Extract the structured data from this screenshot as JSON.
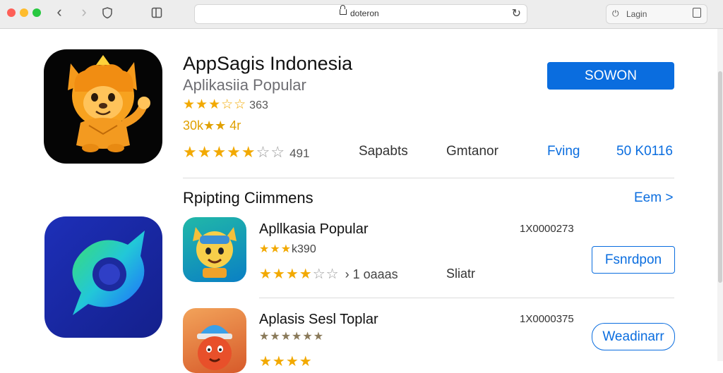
{
  "browser": {
    "url": "doteron",
    "login_label": "Lagin"
  },
  "app": {
    "title": "AppSagis Indonesia",
    "subtitle": "Aplikasiia Popular",
    "rating_row1_stars": "★★★☆☆",
    "rating_row1_count": "363",
    "rating_row2_text": "30k★★ 4r",
    "rating_row3_stars": "★★★★★",
    "rating_row3_empty": "☆☆",
    "rating_row3_count": "491",
    "stats": [
      "Sapabts",
      "Gmtanor",
      "Fving",
      "50 K0116"
    ],
    "get_button": "SOWON"
  },
  "section": {
    "title": "Rpipting Ciimmens",
    "see_all": "Eem >"
  },
  "list": [
    {
      "title": "Apllkasia Popular",
      "rank": "1X0000273",
      "rating_small": "★★★",
      "rating_small_count": "k390",
      "stars": "★★★★",
      "stars_empty": "☆☆",
      "count": "› 1 oaaas",
      "meta": "Sliatr",
      "button": "Fsnrdpon"
    },
    {
      "title": "Aplasis Sesl Toplar",
      "rank": "1X0000375",
      "rating_small": "★★★★★★",
      "rating_small_count": "",
      "stars": "★★★★",
      "stars_empty": "",
      "count": "",
      "meta": "",
      "button": "Weadinarr"
    }
  ],
  "colors": {
    "accent": "#0a6ddf",
    "star": "#f2a900"
  }
}
